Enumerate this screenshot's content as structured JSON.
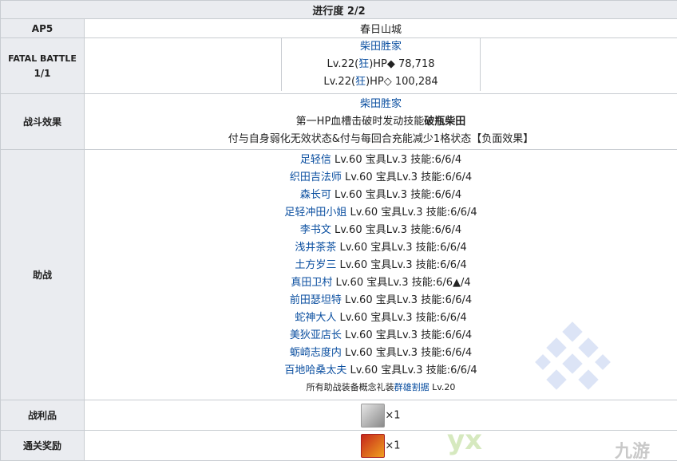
{
  "header": {
    "title": "进行度 2/2"
  },
  "ap": {
    "label": "AP5",
    "value": "春日山城"
  },
  "fatal": {
    "label_line1": "FATAL BATTLE",
    "label_line2": "1/1",
    "boss_name": "柴田胜家",
    "line1": {
      "pre": "Lv.22(",
      "mad": "狂",
      "post": ")HP◆ 78,718"
    },
    "line2": {
      "pre": "Lv.22(",
      "mad": "狂",
      "post": ")HP◇ 100,284"
    }
  },
  "effect": {
    "label": "战斗效果",
    "name": "柴田胜家",
    "line1_pre": "第一HP血槽击破时发动技能",
    "line1_bold": "破瓶柴田",
    "line2": "付与自身弱化无效状态&付与每回合充能减少1格状态【负面效果】"
  },
  "support": {
    "label": "助战",
    "rows": [
      {
        "name": "足轻信",
        "rest": " Lv.60 宝具Lv.3 技能:6/6/4"
      },
      {
        "name": "织田吉法师",
        "rest": " Lv.60 宝具Lv.3 技能:6/6/4"
      },
      {
        "name": "森长可",
        "rest": " Lv.60 宝具Lv.3 技能:6/6/4"
      },
      {
        "name": "足轻冲田小姐",
        "rest": " Lv.60 宝具Lv.3 技能:6/6/4"
      },
      {
        "name": "李书文",
        "rest": " Lv.60 宝具Lv.3 技能:6/6/4"
      },
      {
        "name": "浅井茶茶",
        "rest": " Lv.60 宝具Lv.3 技能:6/6/4"
      },
      {
        "name": "土方岁三",
        "rest": " Lv.60 宝具Lv.3 技能:6/6/4"
      },
      {
        "name": "真田卫村",
        "rest": " Lv.60 宝具Lv.3 技能:6/6▲/4"
      },
      {
        "name": "前田瑟坦特",
        "rest": " Lv.60 宝具Lv.3 技能:6/6/4"
      },
      {
        "name": "蛇神大人",
        "rest": " Lv.60 宝具Lv.3 技能:6/6/4"
      },
      {
        "name": "美狄亚店长",
        "rest": " Lv.60 宝具Lv.3 技能:6/6/4"
      },
      {
        "name": "蛎崎志度内",
        "rest": " Lv.60 宝具Lv.3 技能:6/6/4"
      },
      {
        "name": "百地哈桑太夫",
        "rest": " Lv.60 宝具Lv.3 技能:6/6/4"
      }
    ],
    "footer_pre": "所有助战装备概念礼装",
    "footer_link": "群雄割据",
    "footer_post": " Lv.20"
  },
  "loot": {
    "label": "战利品",
    "count": "×1",
    "icon": "silver-figure-icon"
  },
  "reward": {
    "label": "通关奖励",
    "count": "×1",
    "icon": "red-servant-card-icon"
  },
  "watermark": {
    "text1": "yx",
    "text2": "九游"
  }
}
